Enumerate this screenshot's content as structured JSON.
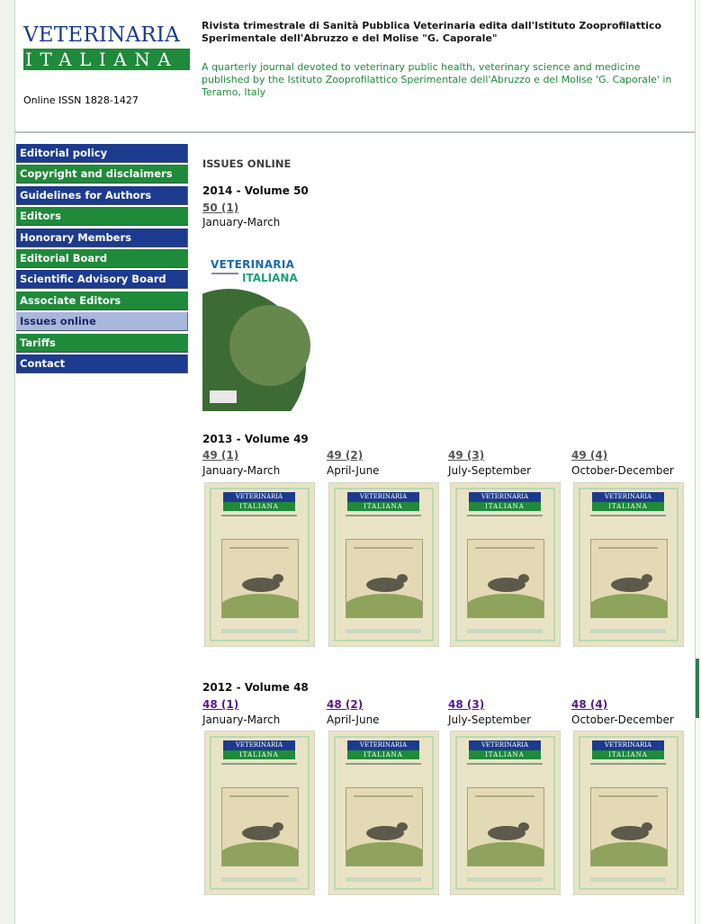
{
  "header": {
    "logo_top": "VETERINARIA",
    "logo_bottom": "ITALIANA",
    "issn": "Online ISSN 1828-1427",
    "desc_it": "Rivista trimestrale di Sanità Pubblica Veterinaria edita dall'Istituto Zooprofilattico Sperimentale dell'Abruzzo e del Molise \"G. Caporale\"",
    "desc_en": "A quarterly journal devoted to veterinary public health, veterinary science and medicine published by the Istituto Zooprofilattico Sperimentale dell'Abruzzo e del Molise 'G. Caporale' in Teramo, Italy"
  },
  "nav": {
    "items": [
      {
        "label": "Editorial policy",
        "style": "blue"
      },
      {
        "label": "Copyright and disclaimers",
        "style": "green"
      },
      {
        "label": "Guidelines for Authors",
        "style": "blue"
      },
      {
        "label": "Editors",
        "style": "green"
      },
      {
        "label": "Honorary Members",
        "style": "blue"
      },
      {
        "label": "Editorial Board",
        "style": "green"
      },
      {
        "label": "Scientific Advisory Board",
        "style": "blue"
      },
      {
        "label": "Associate Editors",
        "style": "green"
      },
      {
        "label": "Issues online",
        "style": "active"
      },
      {
        "label": "Tariffs",
        "style": "green"
      },
      {
        "label": "Contact",
        "style": "blue"
      }
    ]
  },
  "main": {
    "section_title": "ISSUES ONLINE",
    "volumes": [
      {
        "title": "2014 - Volume 50",
        "issues": [
          {
            "link": "50 (1)",
            "period": "January-March"
          }
        ]
      },
      {
        "title": "2013 - Volume 49",
        "issues": [
          {
            "link": "49 (1)",
            "period": "January-March"
          },
          {
            "link": "49 (2)",
            "period": "April-June"
          },
          {
            "link": "49 (3)",
            "period": "July-September"
          },
          {
            "link": "49 (4)",
            "period": "October-December"
          }
        ]
      },
      {
        "title": "2012 - Volume 48",
        "issues": [
          {
            "link": "48 (1)",
            "period": "January-March"
          },
          {
            "link": "48 (2)",
            "period": "April-June"
          },
          {
            "link": "48 (3)",
            "period": "July-September"
          },
          {
            "link": "48 (4)",
            "period": "October-December"
          }
        ]
      }
    ],
    "cover_2014": {
      "line1": "VETERINARIA",
      "line2": "ITALIANA"
    },
    "cover_logo": {
      "line1": "VETERINARIA",
      "line2": "ITALIANA"
    }
  },
  "colors": {
    "brand_blue": "#1c3b8e",
    "brand_green": "#1f8a3a",
    "nav_active": "#aab7dc",
    "visited_link": "#551a8b"
  }
}
